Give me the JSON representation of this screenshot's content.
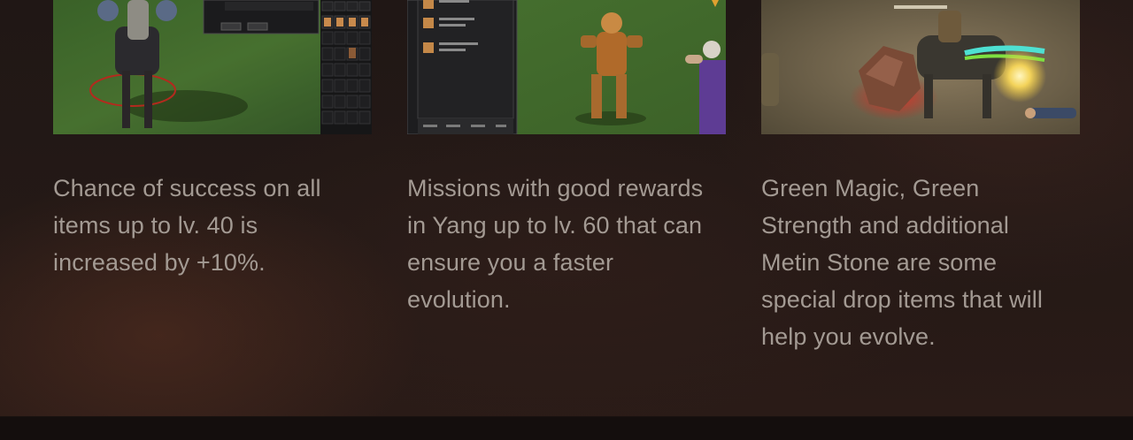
{
  "features": [
    {
      "image_alt": "Game screenshot: armored rider on horse with inventory window",
      "description": "Chance of success on all items up to lv. 40 is increased by +10%."
    },
    {
      "image_alt": "Game screenshot: quest list window and warrior character",
      "description": "Missions with good rewards in Yang up to lv. 60 that can ensure you a faster evolution."
    },
    {
      "image_alt": "Game screenshot: rider near glowing Metin Stone",
      "description": "Green Magic, Green Strength and additional Metin Stone are some special drop items that will help you evolve."
    }
  ],
  "colors": {
    "background": "#231816",
    "text": "#a39a93",
    "footer": "#140e0d"
  }
}
